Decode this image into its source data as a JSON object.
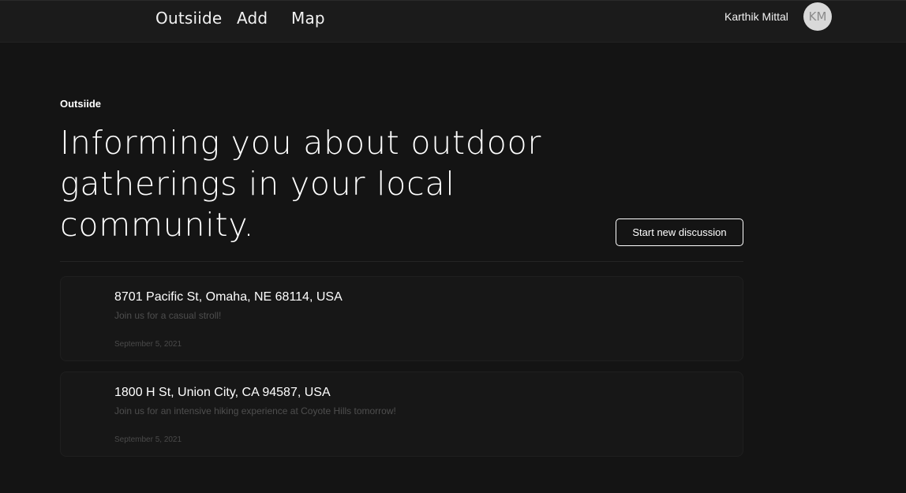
{
  "nav": {
    "brand": "Outsiide",
    "add": "Add",
    "map": "Map"
  },
  "user": {
    "name": "Karthik Mittal",
    "initials": "KM"
  },
  "hero": {
    "kicker": "Outsiide",
    "headline": "Informing you about outdoor gatherings in your local community."
  },
  "actions": {
    "start_discussion": "Start new discussion"
  },
  "discussions": [
    {
      "address": "8701 Pacific St, Omaha, NE 68114, USA",
      "description": "Join us for a casual stroll!",
      "date": "September 5, 2021"
    },
    {
      "address": "1800 H St, Union City, CA 94587, USA",
      "description": "Join us for an intensive hiking experience at Coyote Hills tomorrow!",
      "date": "September 5, 2021"
    }
  ],
  "colors": {
    "background": "#141414",
    "topbar": "#1b1b1b",
    "card": "#171717",
    "text": "#ffffff",
    "muted": "#4e4e4e",
    "avatar": "#d9d9d9"
  }
}
